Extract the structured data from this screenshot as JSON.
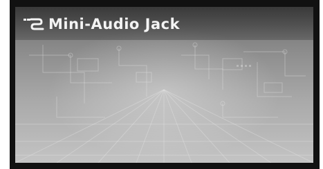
{
  "screen": {
    "title": "Mini-Audio Jack",
    "title_icon": "audio-jack-icon"
  },
  "colors": {
    "bezel": "#111111",
    "title_text": "#f4f4f4"
  }
}
